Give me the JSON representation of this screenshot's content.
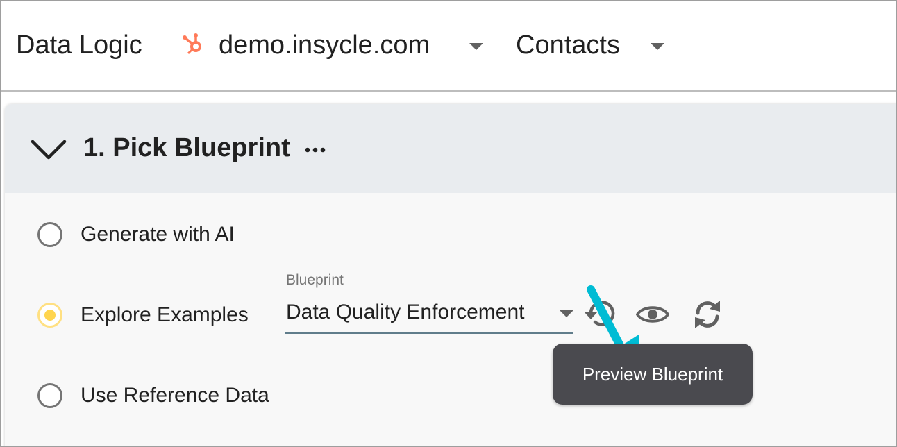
{
  "header": {
    "app_title": "Data Logic",
    "account": "demo.insycle.com",
    "object": "Contacts"
  },
  "section": {
    "title": "1. Pick Blueprint",
    "options": [
      {
        "label": "Generate with AI",
        "selected": false
      },
      {
        "label": "Explore Examples",
        "selected": true
      },
      {
        "label": "Use Reference Data",
        "selected": false
      }
    ],
    "blueprint_field": {
      "label": "Blueprint",
      "value": "Data Quality Enforcement"
    },
    "tooltip": "Preview Blueprint"
  },
  "icons": {
    "account_icon": "hubspot-icon",
    "collapse": "chevron-down-icon",
    "more": "more-horizontal-icon",
    "reset": "history-icon",
    "preview": "eye-icon",
    "refresh": "refresh-icon"
  },
  "colors": {
    "hubspot": "#ff7a59",
    "selected_radio": "#ffd54f",
    "annotation_arrow": "#00bcd4",
    "tooltip_bg": "#4a4a4f"
  }
}
